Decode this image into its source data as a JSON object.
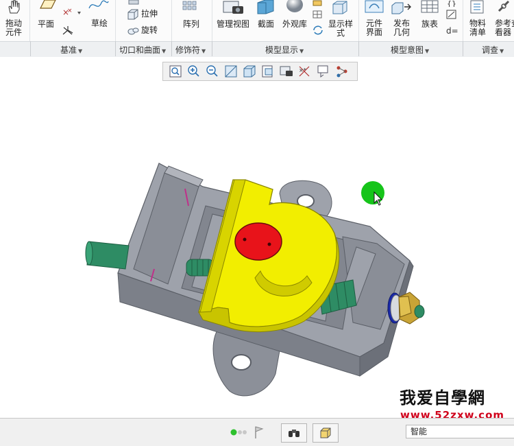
{
  "ribbon": {
    "buttons": {
      "drag": "拖动\n元件",
      "plane": "平面",
      "sketch": "草绘",
      "extrude": "拉伸",
      "revolve": "旋转",
      "pattern": "阵列",
      "manage_views": "管理视图",
      "section": "截面",
      "appearance": "外观库",
      "display_style": "显示样\n式",
      "component_interface": "元件\n界面",
      "publish_geometry": "发布\n几何",
      "family_table": "族表",
      "bill_of_materials": "物料\n清单",
      "reference_viewer": "参考查\n看器"
    },
    "groups": {
      "datum": "基准",
      "cut_surface": "切口和曲面",
      "modifiers": "修饰符",
      "model_display": "模型显示",
      "model_intent": "模型意图",
      "investigate": "调查"
    }
  },
  "status": {
    "filter_value": "智能"
  },
  "watermark": {
    "line1": "我爱自學網",
    "line2": "www.52zxw.com"
  },
  "colors": {
    "clamp_yellow": "#f2ee00",
    "body_gray": "#8c9099",
    "screw_green": "#2e8c64",
    "core_red": "#e8131a",
    "cursor_green": "#16c41a"
  }
}
